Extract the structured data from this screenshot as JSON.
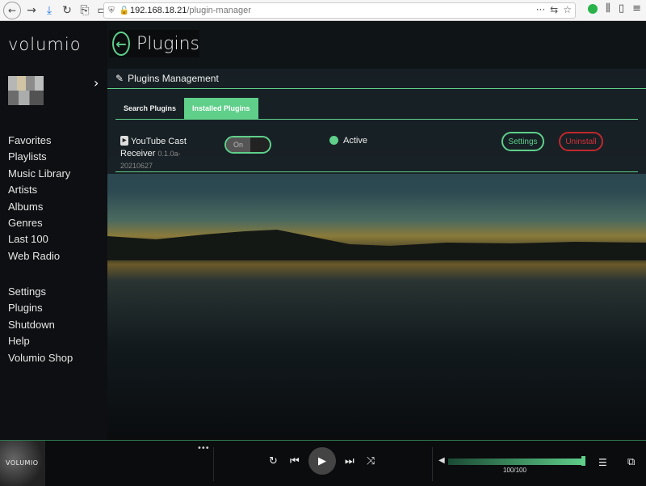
{
  "browser": {
    "url_host": "192.168.18.21",
    "url_path": "/plugin-manager"
  },
  "sidebar": {
    "logo": "volumio",
    "menu_main": [
      "Favorites",
      "Playlists",
      "Music Library",
      "Artists",
      "Albums",
      "Genres",
      "Last 100",
      "Web Radio"
    ],
    "menu_system": [
      "Settings",
      "Plugins",
      "Shutdown",
      "Help",
      "Volumio Shop"
    ]
  },
  "page": {
    "title": "Plugins"
  },
  "panel": {
    "heading": "Plugins Management",
    "tabs": [
      "Search Plugins",
      "Installed Plugins"
    ],
    "active_tab": 1
  },
  "plugin": {
    "name": "YouTube Cast Receiver",
    "version": "0.1.0a-20210627",
    "toggle_label": "On",
    "status": "Active",
    "settings_label": "Settings",
    "uninstall_label": "Uninstall"
  },
  "player": {
    "album_logo": "VOLUMIO",
    "volume_label": "100/100",
    "volume_fraction": 1.0
  },
  "colors": {
    "accent": "#5fcf8a",
    "danger": "#d63238"
  }
}
